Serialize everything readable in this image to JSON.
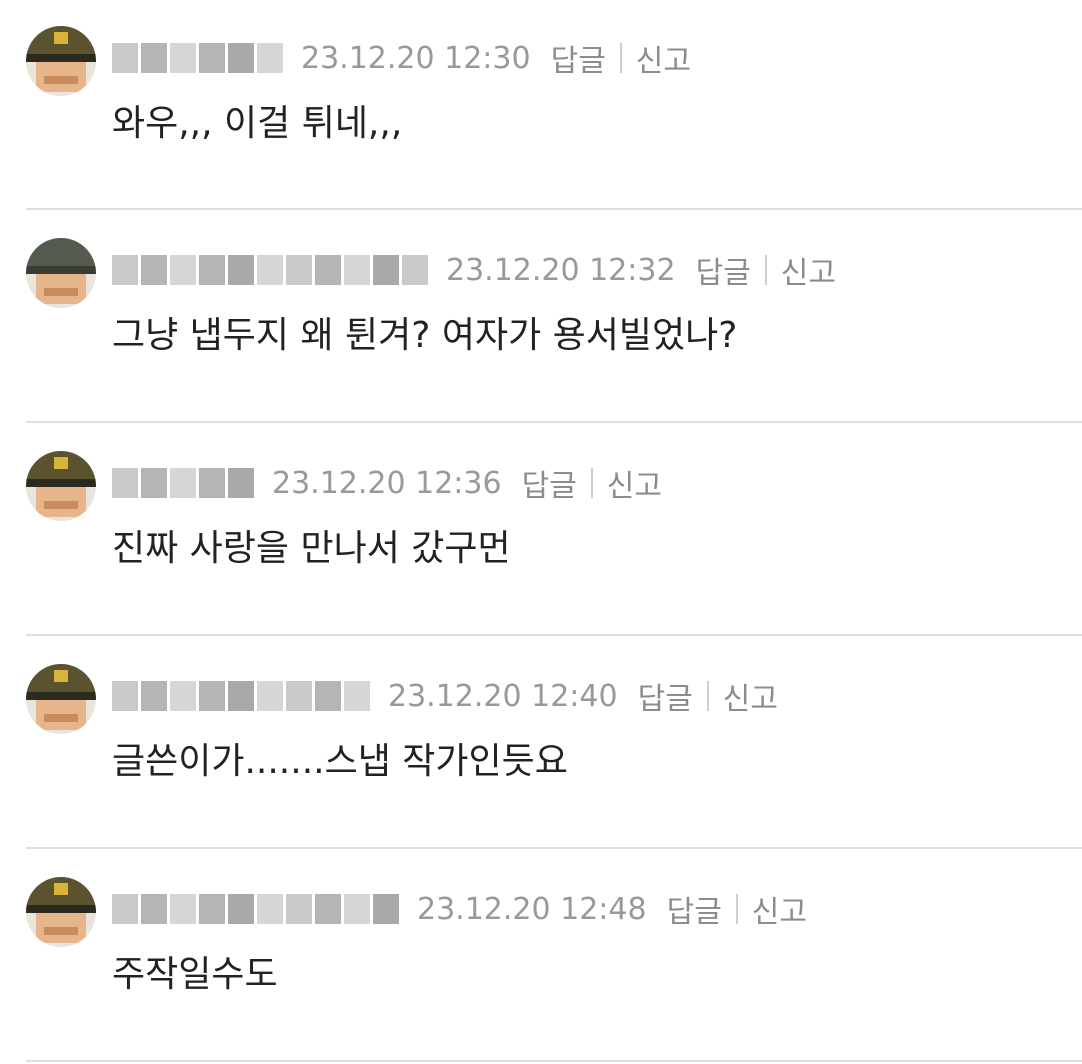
{
  "comments": [
    {
      "date": "23.12.20 12:30",
      "reply": "답글",
      "report": "신고",
      "text": "와우,,, 이걸 튀네,,,"
    },
    {
      "date": "23.12.20 12:32",
      "reply": "답글",
      "report": "신고",
      "text": "그냥 냅두지 왜 튄겨? 여자가 용서빌었나?"
    },
    {
      "date": "23.12.20 12:36",
      "reply": "답글",
      "report": "신고",
      "text": "진짜 사랑을 만나서 갔구먼"
    },
    {
      "date": "23.12.20 12:40",
      "reply": "답글",
      "report": "신고",
      "text": "글쓴이가.......스냅 작가인듯요"
    },
    {
      "date": "23.12.20 12:48",
      "reply": "답글",
      "report": "신고",
      "text": "주작일수도"
    }
  ]
}
